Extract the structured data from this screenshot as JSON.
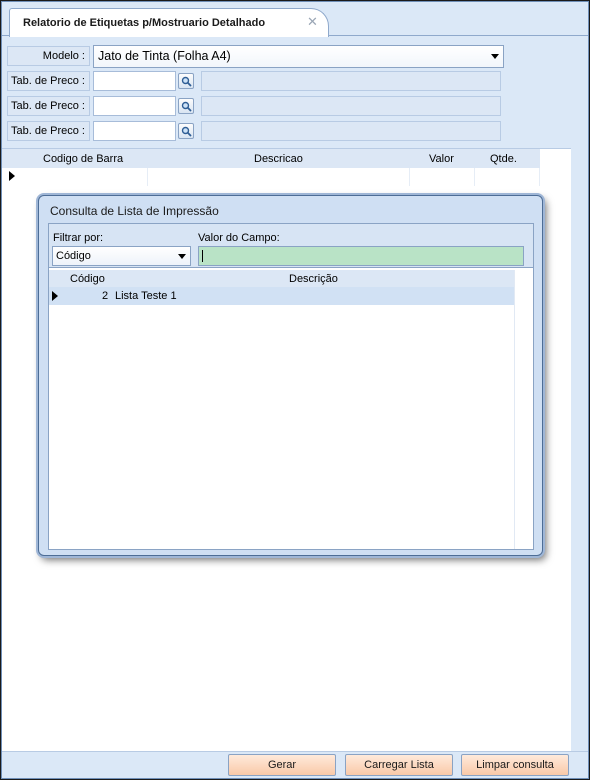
{
  "tab": {
    "title": "Relatorio de Etiquetas p/Mostruario  Detalhado",
    "close_glyph": "✕"
  },
  "form": {
    "modelo_label": "Modelo :",
    "modelo_value": "Jato de Tinta (Folha A4)",
    "tab_preco_rows": [
      {
        "label": "Tab. de Preco :",
        "value": "",
        "description": ""
      },
      {
        "label": "Tab. de Preco :",
        "value": "",
        "description": ""
      },
      {
        "label": "Tab. de Preco :",
        "value": "",
        "description": ""
      }
    ]
  },
  "grid": {
    "columns": [
      "Codigo de Barra",
      "Descricao",
      "Valor",
      "Qtde."
    ]
  },
  "dialog": {
    "title": "Consulta de Lista de Impressão",
    "filter_label": "Filtrar por:",
    "filter_value": "Código",
    "field_label": "Valor do Campo:",
    "field_value": "",
    "columns": [
      "Código",
      "Descrição"
    ],
    "rows": [
      {
        "codigo": "2",
        "descricao": "Lista Teste 1"
      }
    ]
  },
  "buttons": {
    "gerar": "Gerar",
    "carregar": "Carregar Lista",
    "limpar": "Limpar consulta"
  },
  "colors": {
    "window_bg": "#dbe8f7",
    "button_bg": "#f9c9a8",
    "search_field_bg": "#b9e3c6"
  }
}
